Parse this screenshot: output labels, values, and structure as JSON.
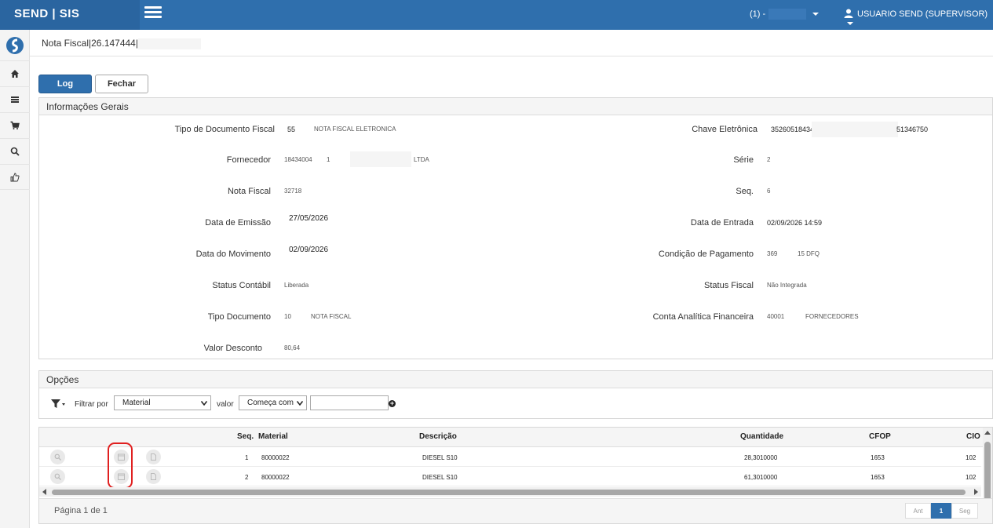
{
  "topbar": {
    "brand": "SEND | SIS",
    "company": "(1) -",
    "user": "USUARIO SEND (SUPERVISOR)",
    "color": "#2f6fad"
  },
  "sidebar": {
    "items": [
      {
        "icon": "home-icon"
      },
      {
        "icon": "list-icon"
      },
      {
        "icon": "cart-icon"
      },
      {
        "icon": "search-icon"
      },
      {
        "icon": "thumbs-up-icon"
      }
    ]
  },
  "page": {
    "title": "Nota Fiscal|26.147444|"
  },
  "buttons": {
    "log": "Log",
    "close": "Fechar"
  },
  "info": {
    "heading": "Informações Gerais",
    "left": [
      {
        "label": "Tipo de Documento Fiscal",
        "v1": "55",
        "v2": "NOTA FISCAL ELETRONICA",
        "v3": ""
      },
      {
        "label": "Fornecedor",
        "v1": "18434004",
        "v2": "1",
        "v3": "LTDA"
      },
      {
        "label": "Nota Fiscal",
        "v1": "32718",
        "v2": "",
        "v3": ""
      },
      {
        "label": "Data de Emissão",
        "v1": "27/05/2026",
        "v2": "",
        "v3": ""
      },
      {
        "label": "Data do Movimento",
        "v1": "02/09/2026",
        "v2": "",
        "v3": ""
      },
      {
        "label": "Status Contábil",
        "v1": "Liberada",
        "v2": "",
        "v3": ""
      },
      {
        "label": "Tipo Documento",
        "v1": "10",
        "v2": "NOTA FISCAL",
        "v3": ""
      },
      {
        "label": "Valor Desconto",
        "v1": "80,64",
        "v2": "",
        "v3": ""
      }
    ],
    "right": [
      {
        "label": "Chave Eletrônica",
        "v1": "35260518434C",
        "v2": "51346750"
      },
      {
        "label": "Série",
        "v1": "2",
        "v2": ""
      },
      {
        "label": "Seq.",
        "v1": "6",
        "v2": ""
      },
      {
        "label": "Data de Entrada",
        "v1": "02/09/2026 14:59",
        "v2": ""
      },
      {
        "label": "Condição de Pagamento",
        "v1": "369",
        "v2": "15 DFQ"
      },
      {
        "label": "Status Fiscal",
        "v1": "Não Integrada",
        "v2": ""
      },
      {
        "label": "Conta Analítica Financeira",
        "v1": "40001",
        "v2": "FORNECEDORES"
      }
    ]
  },
  "options": {
    "heading": "Opções",
    "filter_label": "Filtrar por",
    "filter_value": "Material",
    "value_label": "valor",
    "match_value": "Começa com",
    "search_value": ""
  },
  "grid": {
    "columns": [
      "Seq.",
      "Material",
      "Descrição",
      "Quantidade",
      "CFOP",
      "CIO"
    ],
    "rows": [
      {
        "seq": "1",
        "material": "80000022",
        "descricao": "DIESEL S10",
        "quantidade": "28,3010000",
        "cfop": "1653",
        "cio": "102"
      },
      {
        "seq": "2",
        "material": "80000022",
        "descricao": "DIESEL S10",
        "quantidade": "61,3010000",
        "cfop": "1653",
        "cio": "102"
      }
    ],
    "page_info": "Página 1 de 1",
    "prev": "Ant",
    "current": "1",
    "next": "Seg"
  }
}
